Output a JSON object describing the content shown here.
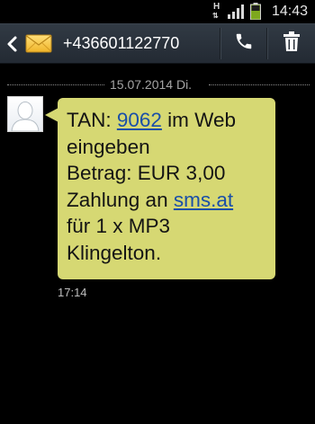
{
  "status_bar": {
    "network_type": "H",
    "time": "14:43"
  },
  "header": {
    "contact_number": "+436601122770",
    "accent_color": "#313a44"
  },
  "conversation": {
    "date_separator": "15.07.2014 Di.",
    "message": {
      "line1_prefix": "TAN: ",
      "line1_link": "9062",
      "line1_suffix": " im Web",
      "line2": "eingeben",
      "line3": "Betrag: EUR 3,00",
      "line4_prefix": "Zahlung an ",
      "line4_link": "sms.at",
      "line5": "für 1 x MP3",
      "line6": "Klingelton.",
      "time": "17:14",
      "bubble_color": "#d6d873",
      "link_color": "#1a4fa8"
    }
  },
  "icons": [
    "back-icon",
    "envelope-icon",
    "phone-icon",
    "trash-icon",
    "signal-icon",
    "battery-icon",
    "avatar-icon"
  ]
}
